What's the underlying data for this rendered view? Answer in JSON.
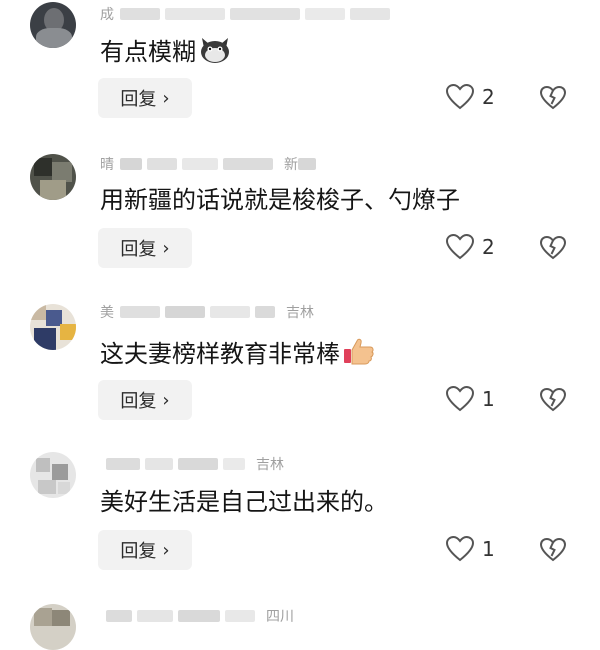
{
  "comments": [
    {
      "name_first": "成",
      "name_last": "",
      "text": "有点模糊",
      "emoji": "cat-face-emoji",
      "reply_label": "回复",
      "likes": "2"
    },
    {
      "name_first": "晴",
      "name_last": "新",
      "text": "用新疆的话说就是梭梭子、勺燎子",
      "emoji": "",
      "reply_label": "回复",
      "likes": "2"
    },
    {
      "name_first": "美",
      "name_last": "吉林",
      "text": "这夫妻榜样教育非常棒",
      "emoji": "thumbs-up-emoji",
      "reply_label": "回复",
      "likes": "1"
    },
    {
      "name_first": "",
      "name_last": "吉林",
      "text": "美好生活是自己过出来的。",
      "emoji": "",
      "reply_label": "回复",
      "likes": "1"
    },
    {
      "name_first": "",
      "name_last": "四川",
      "text": "",
      "emoji": "",
      "reply_label": "",
      "likes": ""
    }
  ],
  "icons": {
    "reply_chevron": "chevron-right-icon",
    "like": "heart-outline-icon",
    "dislike": "broken-heart-icon"
  },
  "colors": {
    "background": "#ffffff",
    "reply_button": "#f2f2f2",
    "meta_text": "#a0a0a0",
    "comment_text": "#151515"
  }
}
